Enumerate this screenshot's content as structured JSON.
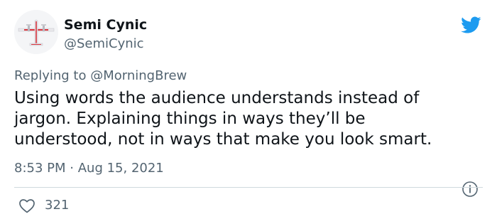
{
  "user": {
    "display_name": "Semi Cynic",
    "handle": "@SemiCynic",
    "avatar_icon": "airplane-icon"
  },
  "logo": {
    "icon": "twitter-bird-icon",
    "color": "#1d9bf0"
  },
  "reply": {
    "prefix": "Replying to",
    "target": "@MorningBrew"
  },
  "tweet": {
    "text": "Using words the audience understands instead of\njargon.  Explaining things in ways they’ll be\nunderstood, not in ways that make you look smart.",
    "time": "8:53 PM",
    "separator": "·",
    "date": "Aug 15, 2021",
    "info_icon": "info-icon"
  },
  "engagement": {
    "likes_icon": "heart-icon",
    "likes": "321"
  },
  "colors": {
    "text_primary": "#0f1419",
    "text_secondary": "#536471",
    "divider": "#cfd9de"
  }
}
